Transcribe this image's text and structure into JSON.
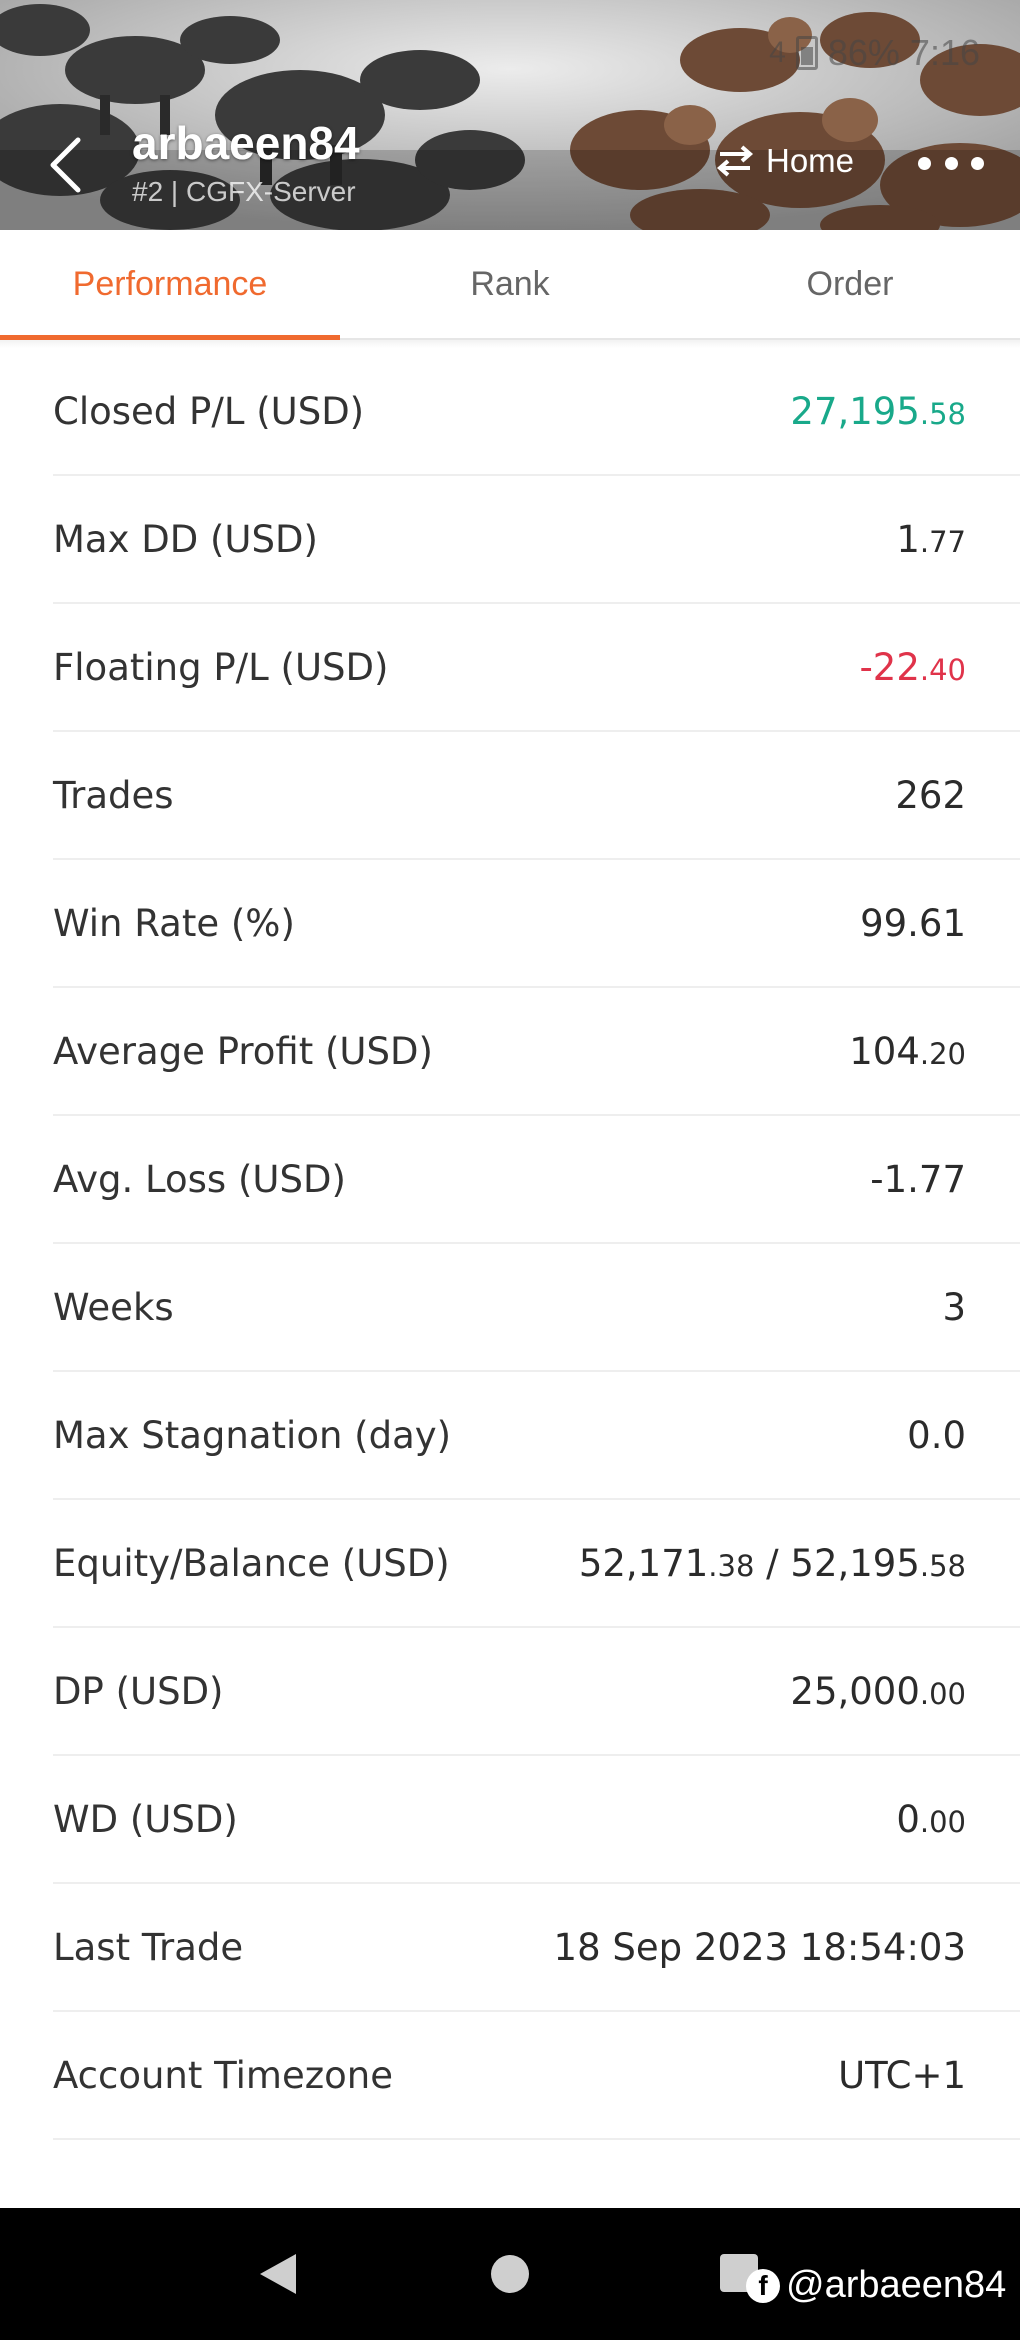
{
  "status_bar": {
    "signal": "4",
    "battery": "86%",
    "time": "7:16"
  },
  "header": {
    "title": "arbaeen84",
    "subtitle": "#2 | CGFX-Server",
    "home_label": "Home"
  },
  "tabs": [
    {
      "label": "Performance",
      "active": true
    },
    {
      "label": "Rank",
      "active": false
    },
    {
      "label": "Order",
      "active": false
    }
  ],
  "stats": [
    {
      "label": "Closed P/L (USD)",
      "value_int": "27,195",
      "value_dec": ".58",
      "color": "#19a98a"
    },
    {
      "label": "Max DD (USD)",
      "value_int": "1",
      "value_dec": ".77"
    },
    {
      "label": "Floating P/L (USD)",
      "value_int": "-22",
      "value_dec": ".40",
      "color": "#e0334a"
    },
    {
      "label": "Trades",
      "value_int": "262",
      "value_dec": ""
    },
    {
      "label": "Win Rate (%)",
      "value_int": "99.61",
      "value_dec": ""
    },
    {
      "label": "Average Profit (USD)",
      "value_int": "104",
      "value_dec": ".20"
    },
    {
      "label": "Avg. Loss (USD)",
      "value_int": "-1.77",
      "value_dec": ""
    },
    {
      "label": "Weeks",
      "value_int": "3",
      "value_dec": ""
    },
    {
      "label": "Max Stagnation (day)",
      "value_int": "0.0",
      "value_dec": ""
    },
    {
      "label": "Equity/Balance (USD)",
      "equity_int": "52,171",
      "equity_dec": ".38",
      "separator": " / ",
      "balance_int": "52,195",
      "balance_dec": ".58"
    },
    {
      "label": "DP (USD)",
      "value_int": "25,000",
      "value_dec": ".00"
    },
    {
      "label": "WD (USD)",
      "value_int": "0",
      "value_dec": ".00"
    },
    {
      "label": "Last Trade",
      "value_int": "18 Sep 2023 18:54:03",
      "value_dec": ""
    },
    {
      "label": "Account Timezone",
      "value_int": "UTC+1",
      "value_dec": ""
    }
  ],
  "watermark": {
    "icon": "facebook-icon",
    "text": "@arbaeen84"
  },
  "colors": {
    "accent": "#f06a2f",
    "profit": "#19a98a",
    "loss": "#e0334a"
  }
}
